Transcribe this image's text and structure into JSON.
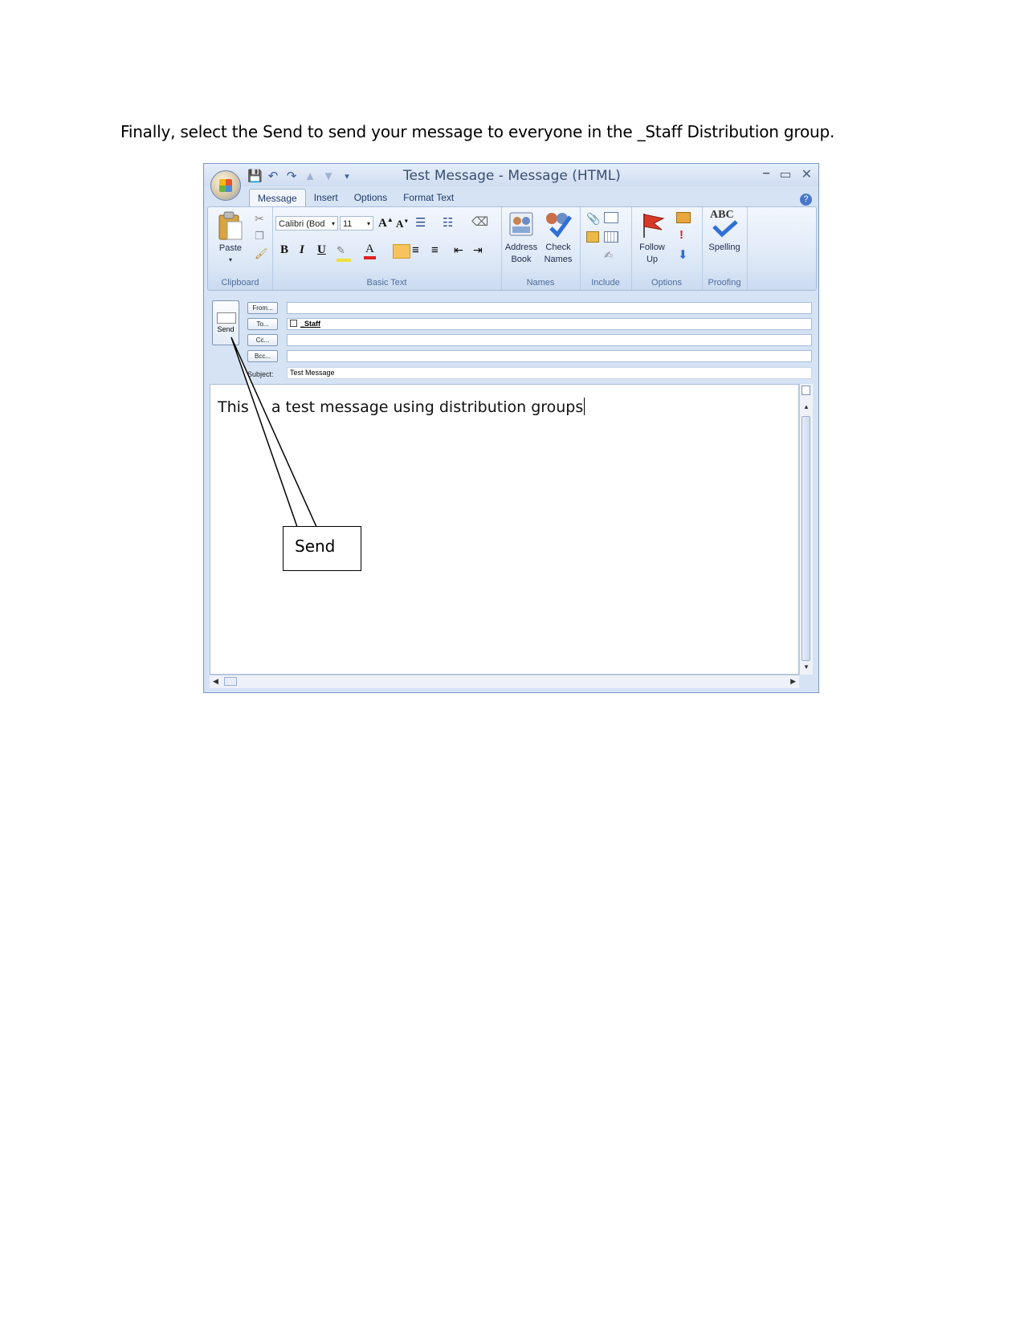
{
  "instruction": "Finally, select the Send to send your message to everyone in the _Staff Distribution group.",
  "window": {
    "title": "Test Message - Message (HTML)",
    "quick_access_icons": [
      "save-icon",
      "undo-icon",
      "redo-icon",
      "previous-icon",
      "next-icon",
      "customize-icon"
    ],
    "controls": {
      "minimize": "–",
      "maximize": "▭",
      "close": "✕"
    }
  },
  "tabs": [
    {
      "label": "Message",
      "active": true
    },
    {
      "label": "Insert",
      "active": false
    },
    {
      "label": "Options",
      "active": false
    },
    {
      "label": "Format Text",
      "active": false
    }
  ],
  "ribbon": {
    "clipboard": {
      "label": "Clipboard",
      "paste": "Paste"
    },
    "basic_text": {
      "label": "Basic Text",
      "font_name": "Calibri (Bod",
      "font_size": "11",
      "bold": "B",
      "italic": "I",
      "underline": "U",
      "font_color_letter": "A"
    },
    "names": {
      "label": "Names",
      "address_book_line1": "Address",
      "address_book_line2": "Book",
      "check_names_line1": "Check",
      "check_names_line2": "Names"
    },
    "include": {
      "label": "Include"
    },
    "options": {
      "label": "Options",
      "follow_up_line1": "Follow",
      "follow_up_line2": "Up"
    },
    "proofing": {
      "label": "Proofing",
      "spelling": "Spelling",
      "abc": "ABC"
    }
  },
  "header": {
    "send_label": "Send",
    "from_label": "From...",
    "to_label": "To...",
    "cc_label": "Cc...",
    "bcc_label": "Bcc...",
    "subject_label": "Subject:",
    "to_value": "_Staff",
    "subject_value": "Test Message"
  },
  "body": {
    "text_start": "This ",
    "text_end": "a test message using distribution groups"
  },
  "callout": {
    "label": "Send"
  },
  "colors": {
    "accent": "#3b5d95",
    "ribbon": "#dbe7f6",
    "frame": "#7b98c4"
  }
}
